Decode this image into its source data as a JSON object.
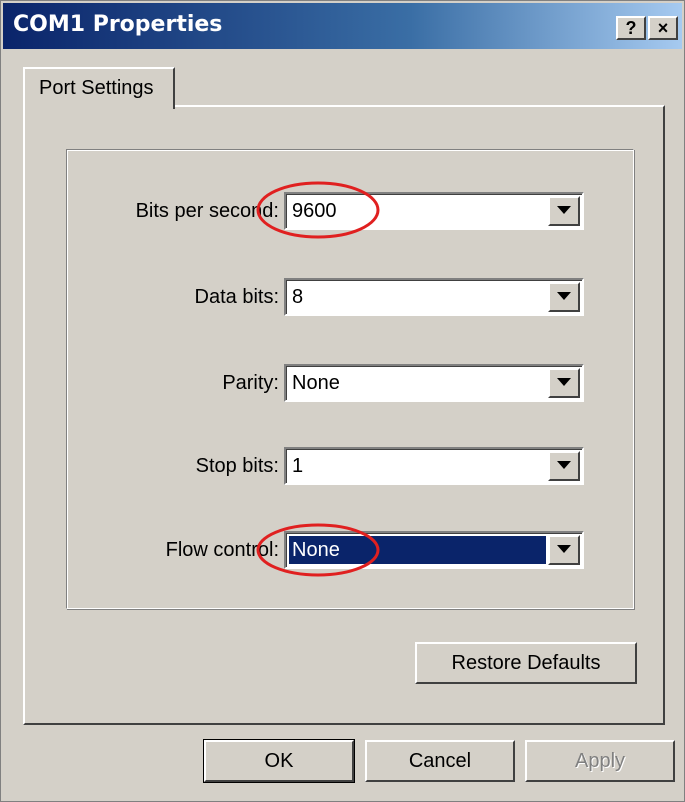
{
  "window": {
    "title": "COM1 Properties",
    "help_button": "?",
    "close_button": "×"
  },
  "tabs": [
    {
      "label": "Port Settings",
      "active": true
    }
  ],
  "fields": [
    {
      "label": "Bits per second:",
      "value": "9600"
    },
    {
      "label": "Data bits:",
      "value": "8"
    },
    {
      "label": "Parity:",
      "value": "None"
    },
    {
      "label": "Stop bits:",
      "value": "1"
    },
    {
      "label": "Flow control:",
      "value": "None",
      "selected": true
    }
  ],
  "buttons": {
    "restore_defaults": "Restore Defaults",
    "ok": "OK",
    "cancel": "Cancel",
    "apply": "Apply"
  },
  "annotations": {
    "highlight_color": "#e02020"
  },
  "colors": {
    "title_bar_start": "#0a246a",
    "title_bar_end": "#a6caf0",
    "dialog_face": "#d4d0c8",
    "selection": "#0a246a"
  }
}
